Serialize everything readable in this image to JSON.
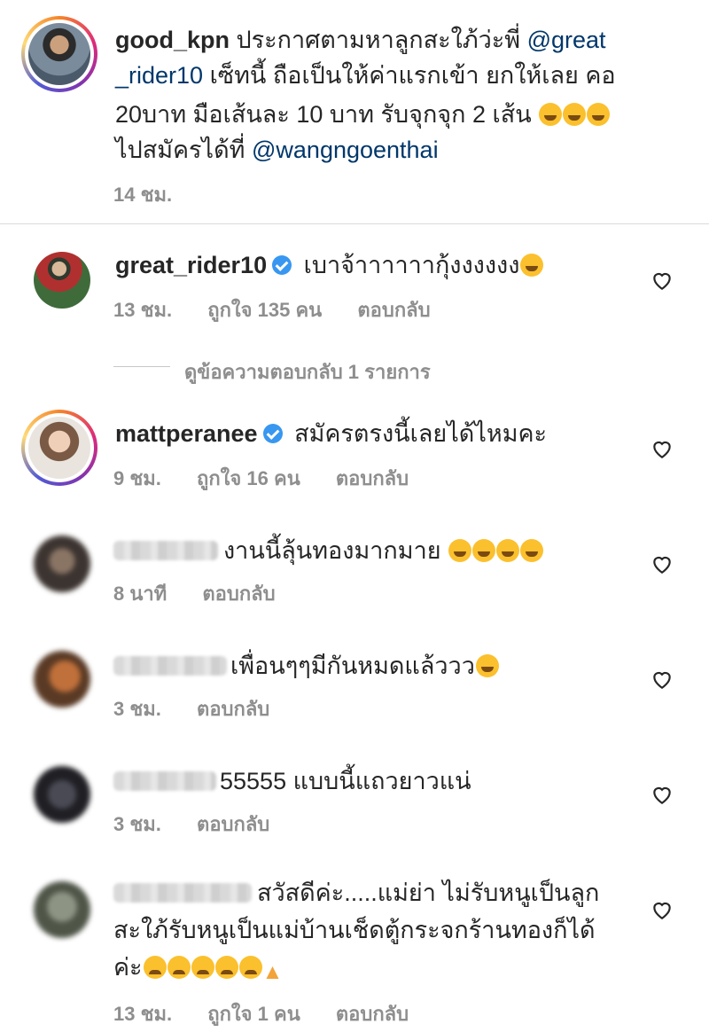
{
  "post": {
    "username": "good_kpn",
    "caption_line1": "ประกาศตามหาลูกสะใภ้ว่ะพี่",
    "mention1_a": "@great",
    "mention1_b": "_rider10",
    "caption_line2": "เซ็ทนี้ ถือเป็นให้ค่าแรกเข้า ยกให้เลย คอ",
    "caption_line3": "20บาท มือเส้นละ 10 บาท รับจุกจุก 2 เส้น",
    "caption_line4": "ไปสมัครได้ที่",
    "mention2": "@wangngoenthai",
    "time": "14 ชม."
  },
  "comments": [
    {
      "username": "great_rider10",
      "text": "เบาจ้าาาาาากุ้งงงงงง",
      "time": "13 ชม.",
      "likes": "ถูกใจ 135 คน",
      "reply": "ตอบกลับ"
    },
    {
      "username": "mattperanee",
      "text": "สมัครตรงนี้เลยได้ไหมคะ",
      "time": "9 ชม.",
      "likes": "ถูกใจ 16 คน",
      "reply": "ตอบกลับ"
    },
    {
      "text": "งานนี้ลุ้นทองมากมาย",
      "time": "8 นาที",
      "reply": "ตอบกลับ"
    },
    {
      "text": "เพื่อนๆๆมีกันหมดแล้ววว",
      "time": "3 ชม.",
      "reply": "ตอบกลับ"
    },
    {
      "text": "55555 แบบนี้แถวยาวแน่",
      "time": "3 ชม.",
      "reply": "ตอบกลับ"
    },
    {
      "text_line1": "สวัสดีค่ะ.....แม่ย่า  ไม่รับหนูเป็นลูก",
      "text_line2": "สะใภ้รับหนูเป็นแม่บ้านเช็ดตู้กระจกร้านทองก็ได้",
      "text_line3": "ค่ะ",
      "time": "13 ชม.",
      "likes": "ถูกใจ 1 คน",
      "reply": "ตอบกลับ"
    }
  ],
  "view_replies": "ดูข้อความตอบกลับ 1 รายการ",
  "icons": {
    "like": "heart-outline-icon",
    "verified": "verified-badge-icon"
  },
  "colors": {
    "mention": "#00376b",
    "meta": "#8e8e8e",
    "verified": "#3897f0"
  }
}
